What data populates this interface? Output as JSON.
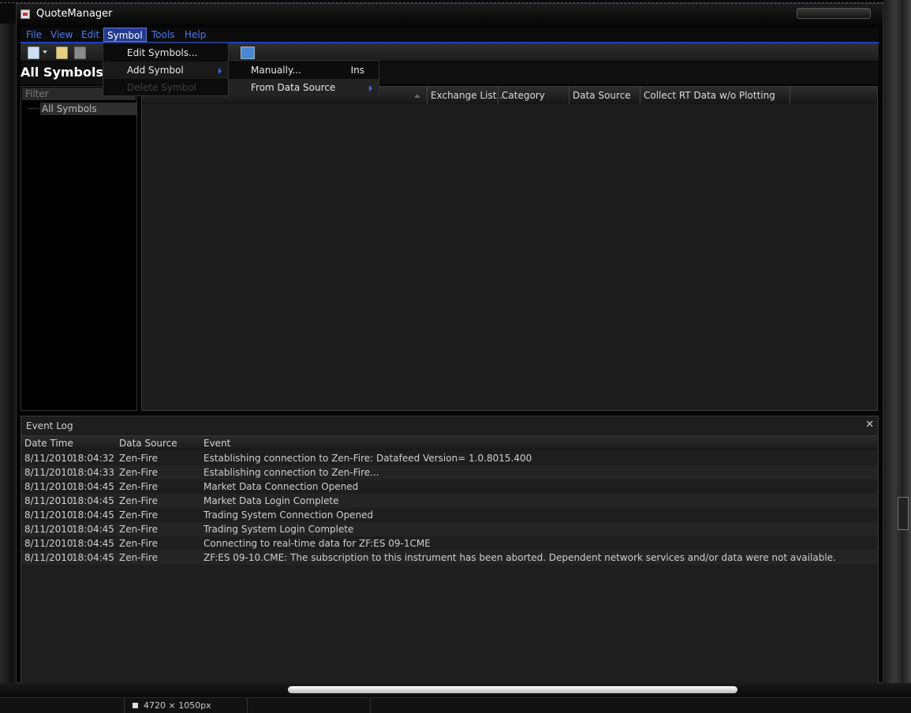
{
  "window": {
    "title": "QuoteManager"
  },
  "menubar": {
    "items": [
      {
        "label": "File"
      },
      {
        "label": "View"
      },
      {
        "label": "Edit"
      },
      {
        "label": "Symbol"
      },
      {
        "label": "Tools"
      },
      {
        "label": "Help"
      }
    ]
  },
  "toolbar": {
    "icons": [
      "new-icon",
      "dropdown-arrow-icon",
      "edit-icon",
      "copy-icon",
      "book-icon"
    ]
  },
  "sidebar": {
    "title": "All Symbols",
    "filter_placeholder": "Filter",
    "tree": [
      {
        "label": "All Symbols"
      }
    ]
  },
  "symbol_grid": {
    "columns": [
      {
        "label": "Exchange List..."
      },
      {
        "label": "Category"
      },
      {
        "label": "Data Source"
      },
      {
        "label": "Collect RT Data w/o Plotting"
      }
    ]
  },
  "symbol_menu": {
    "items": [
      {
        "label": "Edit Symbols...",
        "enabled": true
      },
      {
        "label": "Add Symbol",
        "enabled": true,
        "has_submenu": true
      },
      {
        "label": "Delete Symbol",
        "enabled": false
      }
    ],
    "add_symbol_submenu": [
      {
        "label": "Manually...",
        "shortcut": "Ins"
      },
      {
        "label": "From Data Source",
        "has_submenu": true
      }
    ]
  },
  "event_log": {
    "title": "Event Log",
    "columns": [
      "Date Time",
      "Data Source",
      "Event"
    ],
    "rows": [
      {
        "date": "8/11/2010",
        "time": "18:04:32",
        "source": "Zen-Fire",
        "event": "Establishing connection to Zen-Fire: Datafeed Version= 1.0.8015.400"
      },
      {
        "date": "8/11/2010",
        "time": "18:04:33",
        "source": "Zen-Fire",
        "event": "Establishing connection to Zen-Fire..."
      },
      {
        "date": "8/11/2010",
        "time": "18:04:45",
        "source": "Zen-Fire",
        "event": "Market Data Connection Opened"
      },
      {
        "date": "8/11/2010",
        "time": "18:04:45",
        "source": "Zen-Fire",
        "event": "Market Data Login Complete"
      },
      {
        "date": "8/11/2010",
        "time": "18:04:45",
        "source": "Zen-Fire",
        "event": "Trading System Connection Opened"
      },
      {
        "date": "8/11/2010",
        "time": "18:04:45",
        "source": "Zen-Fire",
        "event": "Trading System Login Complete"
      },
      {
        "date": "8/11/2010",
        "time": "18:04:45",
        "source": "Zen-Fire",
        "event": "Connecting to real-time data for ZF:ES 09-1CME"
      },
      {
        "date": "8/11/2010",
        "time": "18:04:45",
        "source": "Zen-Fire",
        "event": "ZF:ES 09-10.CME: The subscription to this instrument has been aborted.  Dependent network services and/or data were not available."
      }
    ]
  },
  "statusbar": {
    "dimensions": "4720 × 1050px"
  },
  "colors": {
    "accent": "#1f3fbf",
    "menu_text": "#4a7bf0",
    "background": "#1e1e1e"
  }
}
